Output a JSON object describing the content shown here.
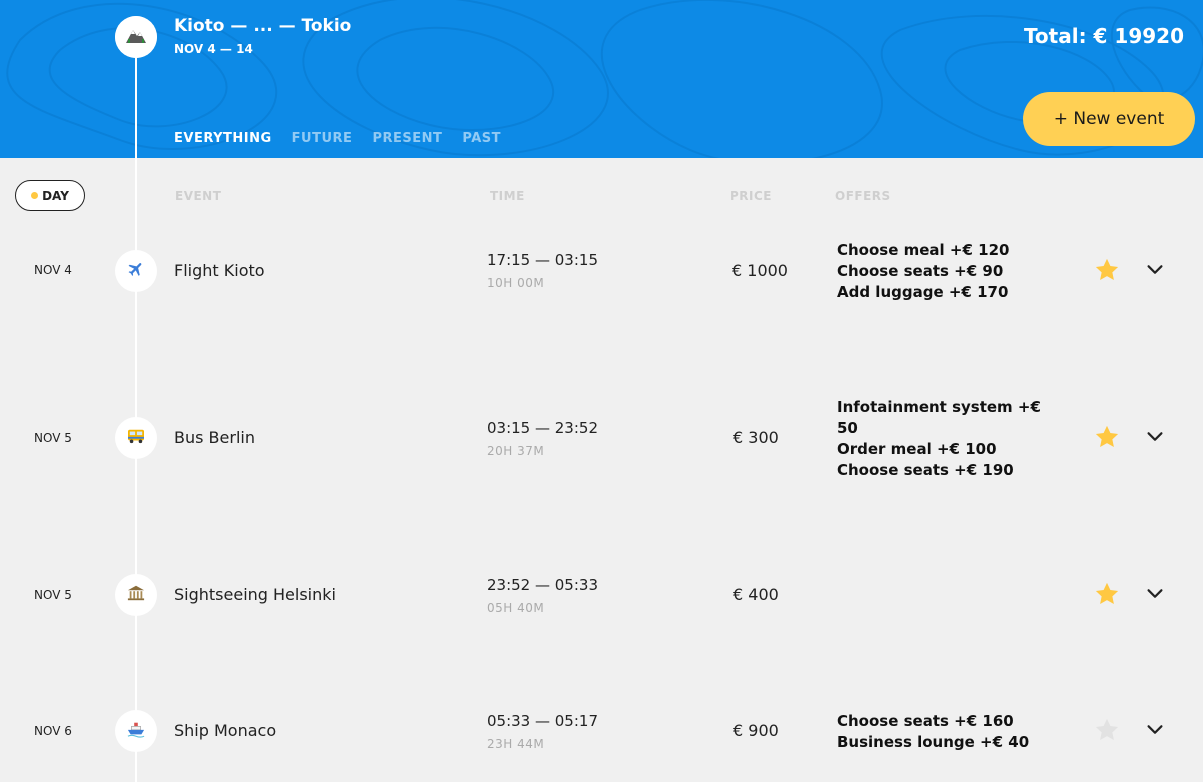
{
  "header": {
    "trip_title": "Kioto — ... — Tokio",
    "trip_dates": "NOV 4 — 14",
    "total_text": "Total: € 19920",
    "logo_icon": "mountain-icon",
    "background_color": "#0d8ae6",
    "accent_color": "#ffd054"
  },
  "filters": [
    {
      "label": "EVERYTHING",
      "active": true
    },
    {
      "label": "FUTURE",
      "active": false
    },
    {
      "label": "PRESENT",
      "active": false
    },
    {
      "label": "PAST",
      "active": false
    }
  ],
  "new_event_label": "+ New event",
  "sort": {
    "day_label": "DAY"
  },
  "columns": {
    "event": "EVENT",
    "time": "TIME",
    "price": "PRICE",
    "offers": "OFFERS"
  },
  "events": [
    {
      "date": "NOV 4",
      "icon": "airplane-icon",
      "name": "Flight Kioto",
      "time": "17:15 — 03:15",
      "duration": "10H 00M",
      "price": "€ 1000",
      "offers": [
        "Choose meal +€  120",
        "Choose seats +€  90",
        "Add luggage +€  170"
      ],
      "favorite": true
    },
    {
      "date": "NOV 5",
      "icon": "bus-icon",
      "name": "Bus Berlin",
      "time": "03:15 — 23:52",
      "duration": "20H 37M",
      "price": "€ 300",
      "offers": [
        "Infotainment system +€  50",
        "Order meal +€  100",
        "Choose seats +€  190"
      ],
      "favorite": true
    },
    {
      "date": "NOV 5",
      "icon": "museum-icon",
      "name": "Sightseeing Helsinki",
      "time": "23:52 — 05:33",
      "duration": "05H 40M",
      "price": "€ 400",
      "offers": [],
      "favorite": true
    },
    {
      "date": "NOV 6",
      "icon": "ship-icon",
      "name": "Ship Monaco",
      "time": "05:33 — 05:17",
      "duration": "23H 44M",
      "price": "€ 900",
      "offers": [
        "Choose seats +€  160",
        "Business lounge +€  40"
      ],
      "favorite": false
    }
  ]
}
